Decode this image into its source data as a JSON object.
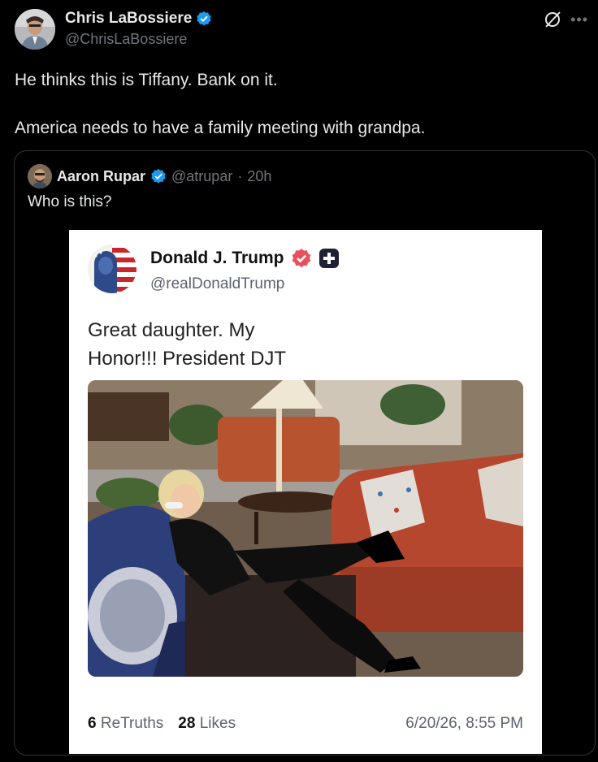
{
  "tweet": {
    "author": {
      "display_name": "Chris LaBossiere",
      "handle": "@ChrisLaBossiere",
      "verified": true
    },
    "text_line1": "He thinks this is Tiffany. Bank on it.",
    "text_line2": "America needs to have a family meeting with grandpa.",
    "icons": [
      "grok-icon",
      "more-icon"
    ]
  },
  "quoted": {
    "display_name": "Aaron Rupar",
    "handle": "@atrupar",
    "time": "20h",
    "text": "Who is this?"
  },
  "truth_post": {
    "display_name": "Donald J. Trump",
    "handle": "@realDonaldTrump",
    "text_line1": "Great daughter. My",
    "text_line2": "Honor!!! President DJT",
    "retruths_count": "6",
    "retruths_label": "ReTruths",
    "likes_count": "28",
    "likes_label": "Likes",
    "date": "6/20/26, 8:55 PM"
  },
  "colors": {
    "background": "#000000",
    "verified_blue": "#1d9bf0",
    "truth_badge": "#e8505b",
    "muted": "#71767b"
  }
}
